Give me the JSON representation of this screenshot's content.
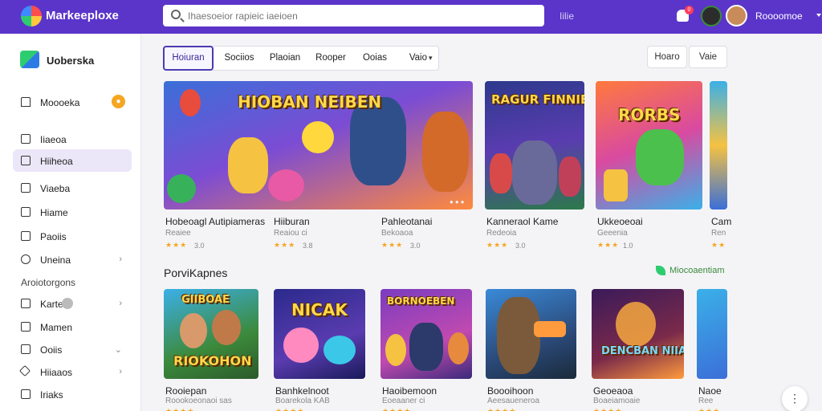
{
  "app": {
    "title": "Markeeploxe"
  },
  "search": {
    "placeholder": "Ihaesoeior rapieic iaeioen"
  },
  "header": {
    "link": "Iilie",
    "badge": "0",
    "username": "Roooomoe"
  },
  "sidebar": {
    "brand": "Uoberska",
    "items": [
      {
        "label": "Moooeka",
        "icon": "home-icon"
      },
      {
        "label": "Iiaeoa",
        "icon": "home-icon"
      },
      {
        "label": "Hiiheoa",
        "icon": "square-icon"
      },
      {
        "label": "Viaeba",
        "icon": "square-icon"
      },
      {
        "label": "Hiame",
        "icon": "figure-icon"
      },
      {
        "label": "Paoiis",
        "icon": "box-icon"
      },
      {
        "label": "Uneina",
        "icon": "circle-icon"
      }
    ],
    "section": "Aroiotorgons",
    "sub_items": [
      {
        "label": "Karte",
        "icon": "figure-icon"
      },
      {
        "label": "Mamen",
        "icon": "box-icon"
      },
      {
        "label": "Ooiis",
        "icon": "box-icon"
      },
      {
        "label": "Hiiaaos",
        "icon": "diamond-icon"
      },
      {
        "label": "Iriaks",
        "icon": "box-icon"
      }
    ]
  },
  "tabs": [
    "Hoiuran",
    "Sociios",
    "Plaoian",
    "Rooper",
    "Ooias",
    "Vaio"
  ],
  "right_buttons": [
    "Hoaro",
    "Vaie"
  ],
  "featured": [
    {
      "title": "Hobeoagl Autipiameras",
      "sub": "Reaiee",
      "rating": "3.0",
      "banner": "HIOBAN NEIBEN"
    },
    {
      "title": "Hiiburan",
      "sub": "Reaiou ci",
      "rating": "3.8"
    },
    {
      "title": "Pahleotanai",
      "sub": "Bekoaoa",
      "rating": "3.0"
    },
    {
      "title": "Kanneraol Kame",
      "sub": "Redeoia",
      "rating": "3.0",
      "banner": "RAGUR FINNIE"
    },
    {
      "title": "Ukkeoeoai",
      "sub": "Geeenia",
      "rating": "1.0",
      "banner": "RORBS"
    },
    {
      "title": "Cam",
      "sub": "Ren"
    }
  ],
  "section": {
    "title": "PorviKapnes",
    "link": "Miocoaentiam"
  },
  "grid": [
    {
      "title": "Rooiepan",
      "sub": "Roookoeonaoi sas",
      "banner": "RIOKOHON",
      "top": "GIIBOAE"
    },
    {
      "title": "Banhkelnoot",
      "sub": "Boarekola KAB",
      "banner": "NICAK"
    },
    {
      "title": "Haoibemoon",
      "sub": "Eoeaaner ci",
      "banner": "BORNOEBEN"
    },
    {
      "title": "Boooihoon",
      "sub": "Aeesaueneroa"
    },
    {
      "title": "Geoeaoa",
      "sub": "Boaeiamoaie",
      "banner": "DENCBAN NIIAMCE"
    },
    {
      "title": "Naoe",
      "sub": "Ree"
    }
  ]
}
